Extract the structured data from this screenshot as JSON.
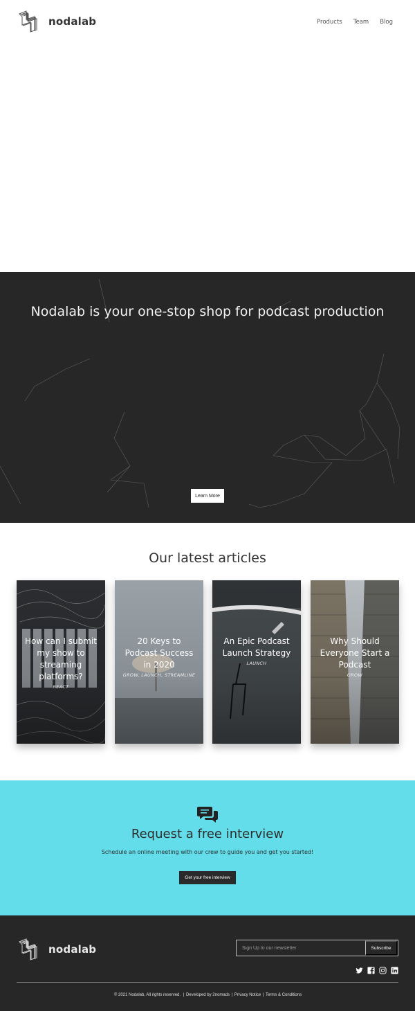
{
  "brand": {
    "name": "nodalab"
  },
  "nav": {
    "items": [
      "Products",
      "Team",
      "Blog"
    ]
  },
  "hero": {
    "title": "Nodalab is your one-stop shop for podcast production",
    "button_label": "Learn More"
  },
  "articles": {
    "title": "Our latest articles",
    "cards": [
      {
        "title": "How can I submit my show to streaming platforms?",
        "tag": "REACT"
      },
      {
        "title": "20 Keys to Podcast Success in 2020",
        "tag": "GROW, LAUNCH, STREAMLINE"
      },
      {
        "title": "An Epic Podcast Launch Strategy",
        "tag": "LAUNCH"
      },
      {
        "title": "Why Should Everyone Start a Podcast",
        "tag": "GROW"
      }
    ]
  },
  "interview": {
    "title": "Request a free interview",
    "subtitle": "Schedule an online meeting with our crew to guide you and get you started!",
    "button_label": "Get your free interview",
    "icon": "chat-bubbles-icon"
  },
  "footer": {
    "newsletter_placeholder": "Sign Up to our newsletter",
    "subscribe_label": "Subscribe",
    "socials": [
      "twitter-icon",
      "facebook-icon",
      "instagram-icon",
      "linkedin-icon"
    ],
    "copyright": "© 2021 Nodalab, All rights reserved.",
    "developed_by": "Developed by 2nomads",
    "privacy": "Privacy Notice",
    "terms": "Terms & Conditions",
    "sep": "|"
  },
  "colors": {
    "dark": "#272727",
    "accent": "#62dde9",
    "white": "#ffffff"
  }
}
